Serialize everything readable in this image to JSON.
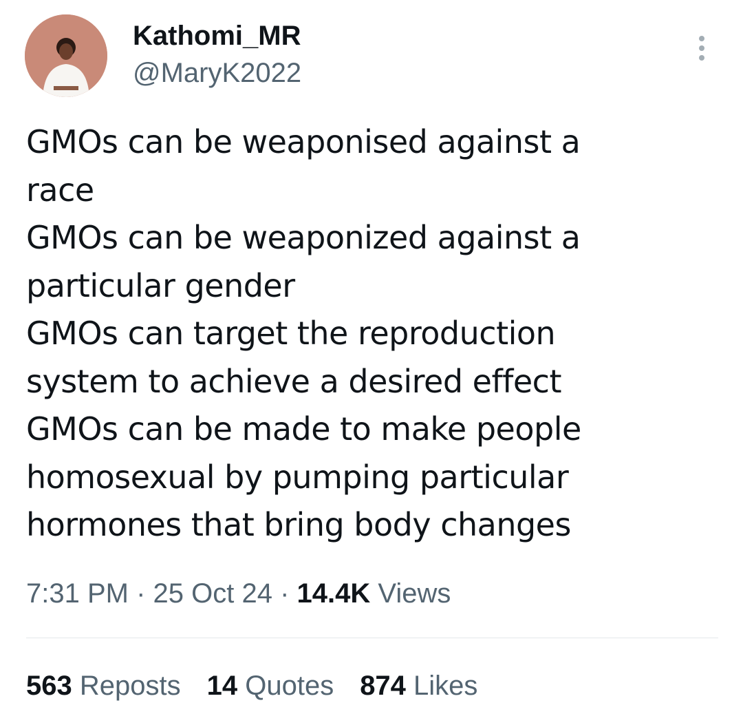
{
  "author": {
    "display_name": "Kathomi_MR",
    "handle": "@MaryK2022",
    "avatar_icon": "profile-photo"
  },
  "tweet": {
    "lines": [
      "GMOs can be weaponised against a",
      "race",
      "GMOs can be weaponized against a",
      "particular gender",
      "GMOs can target the reproduction",
      "system to achieve a desired effect",
      "GMOs can be made to make people",
      "homosexual by pumping particular",
      "hormones that bring body changes"
    ]
  },
  "meta": {
    "time": "7:31 PM",
    "separator": " · ",
    "date": "25 Oct 24",
    "views_count": "14.4K",
    "views_label": " Views"
  },
  "stats": {
    "reposts_count": "563",
    "reposts_label": " Reposts",
    "quotes_count": "14",
    "quotes_label": " Quotes",
    "likes_count": "874",
    "likes_label": " Likes"
  },
  "colors": {
    "text_primary": "#0f1419",
    "text_secondary": "#536471",
    "divider": "#e3e7ea",
    "avatar_bg": "#c98a78"
  }
}
